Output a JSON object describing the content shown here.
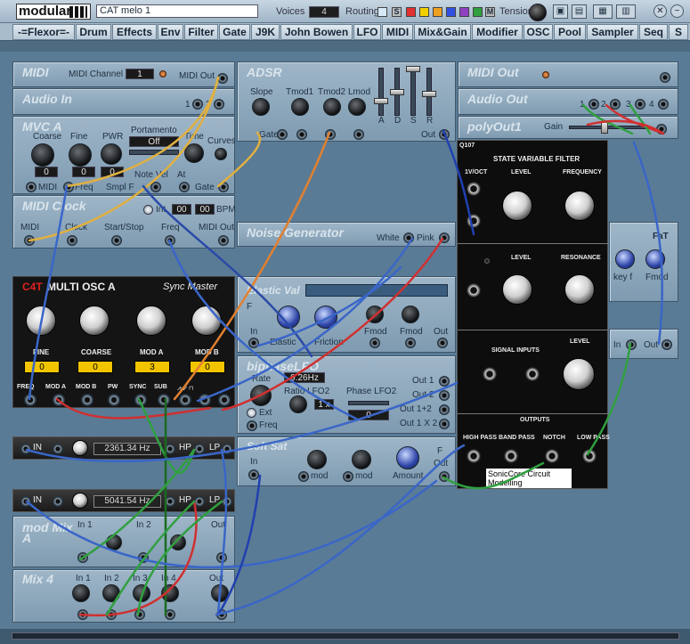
{
  "topbar": {
    "logo": "modular",
    "patch_name": "CAT melo 1",
    "voices_label": "Voices",
    "voices_value": "4",
    "routing_label": "Routing",
    "routing_letter": "S",
    "routing_m": "M",
    "tension_label": "Tension",
    "routing_colors": [
      "#d6e8f4",
      "#e03030",
      "#f0d000",
      "#f0a020",
      "#3050e0",
      "#9040c0",
      "#30a040"
    ]
  },
  "categories": [
    "-=Flexor=-",
    "Drum",
    "Effects",
    "Env",
    "Filter",
    "Gate",
    "J9K",
    "John Bowen",
    "LFO",
    "MIDI",
    "Mix&Gain",
    "Modifier",
    "OSC",
    "Pool",
    "Sampler",
    "Seq",
    "S"
  ],
  "midi": {
    "title": "MIDI",
    "channel_label": "MIDI Channel",
    "channel": "1",
    "out": "MIDI Out"
  },
  "audio_in": {
    "title": "Audio In",
    "ch1": "1",
    "ch2": "2"
  },
  "mvc": {
    "title": "MVC A",
    "coarse": "Coarse",
    "coarse_val": "0",
    "fine": "Fine",
    "fine_val": "0",
    "pwr": "PWR",
    "pwr_val": "0",
    "portamento": "Portamento",
    "portamento_val": "Off",
    "time": "Time",
    "curves": "Curves",
    "note_vel": "Note Vel",
    "at": "At",
    "midi": "MIDI",
    "freq": "Freq",
    "smpl": "Smpl F",
    "gate": "Gate"
  },
  "midi_clock": {
    "title": "MIDI Clock",
    "int": "Int",
    "bpm1": "00",
    "bpm2": "00",
    "bpm": "BPM",
    "midi": "MIDI",
    "clock": "Clock",
    "startstop": "Start/Stop",
    "freq": "Freq",
    "midi_out": "MIDI Out"
  },
  "adsr": {
    "title": "ADSR",
    "slope": "Slope",
    "tmod1": "Tmod1",
    "tmod2": "Tmod2",
    "lmod": "Lmod",
    "gate": "Gate",
    "out": "Out",
    "a": "A",
    "d": "D",
    "s": "S",
    "r": "R"
  },
  "midi_out": {
    "title": "MIDI Out"
  },
  "audio_out": {
    "title": "Audio Out",
    "ch": [
      "1",
      "2",
      "3",
      "4"
    ]
  },
  "polyout": {
    "title": "polyOut1",
    "gain": "Gain"
  },
  "noise": {
    "title": "Noise Generator",
    "white": "White",
    "pink": "Pink"
  },
  "fat": {
    "title": "FaT",
    "keyf": "key f",
    "fmod": "Fmod",
    "in": "In",
    "out": "Out"
  },
  "osc": {
    "brand": "C4T",
    "title": "MULTI OSC A",
    "sync": "Sync Master",
    "knobs": [
      "FINE",
      "COARSE",
      "MOD A",
      "MOD B"
    ],
    "values": [
      "0",
      "0",
      "3",
      "0"
    ],
    "jacks": [
      "FREQ",
      "MOD A",
      "MOD B",
      "PW",
      "SYNC",
      "SUB"
    ]
  },
  "elastic": {
    "title": "Elastic Val",
    "elastic": "Elastic",
    "friction": "Friction",
    "fmod1": "Fmod",
    "fmod2": "Fmod",
    "in": "In",
    "out": "Out",
    "f": "F"
  },
  "biphase": {
    "title": "biphaseLFO",
    "rate": "Rate",
    "rate_val": "9.26Hz",
    "ratio": "Ratio LFO2",
    "ratio_val": "1 x",
    "phase": "Phase LFO2",
    "phase_val": "0",
    "ext": "Ext",
    "freq": "Freq",
    "outs": [
      "Out 1",
      "Out 2",
      "Out 1+2",
      "Out 1 X 2"
    ]
  },
  "filter1": {
    "in": "IN",
    "freq": "2361.34 Hz",
    "hp": "HP",
    "lp": "LP"
  },
  "filter2": {
    "in": "IN",
    "freq": "5041.54 Hz",
    "hp": "HP",
    "lp": "LP"
  },
  "softsat": {
    "title": "Soft Sat",
    "in": "In",
    "mod1": "mod",
    "mod2": "mod",
    "amount": "Amount",
    "out": "Out",
    "f": "F"
  },
  "mixa": {
    "title": "mod Mix A",
    "in1": "In 1",
    "in2": "In 2",
    "out": "Out"
  },
  "mix4": {
    "title": "Mix 4",
    "ins": [
      "In 1",
      "In 2",
      "In 3",
      "In 4"
    ],
    "out": "Out"
  },
  "svf": {
    "code": "Q107",
    "title": "STATE VARIABLE FILTER",
    "v_oct": "1V/OCT",
    "level": "LEVEL",
    "frequency": "FREQUENCY",
    "level2": "LEVEL",
    "resonance": "RESONANCE",
    "signal_inputs": "SIGNAL INPUTS",
    "level3": "LEVEL",
    "outputs": "OUTPUTS",
    "hp": "HIGH PASS",
    "bp": "BAND PASS",
    "notch": "NOTCH",
    "lp": "LOW PASS",
    "maker": "SonicCore Circuit Modelling"
  }
}
